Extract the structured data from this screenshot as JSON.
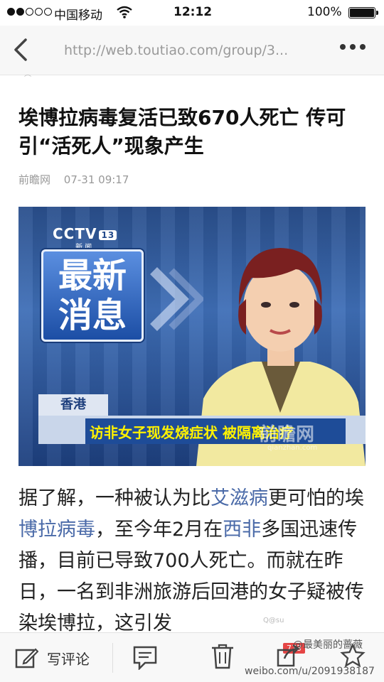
{
  "status_bar": {
    "carrier": "中国移动",
    "time": "12:12",
    "battery": "100%"
  },
  "nav": {
    "url": "http://web.toutiao.com/group/3..."
  },
  "article": {
    "title": "埃博拉病毒复活已致670人死亡 传可引“活死人”现象产生",
    "source": "前瞻网",
    "date": "07-31 09:17",
    "image": {
      "logo": "CCTV",
      "channel": "13",
      "channel_sub": "新闻",
      "badge": "最新消息",
      "location_tag": "香港",
      "ticker": "访非女子现发烧症状 被隔离治疗",
      "watermark": "前瞻网",
      "watermark_url": "qianzhan.com"
    },
    "body": {
      "p1": "据了解，一种被认为比",
      "kw1": "艾滋病",
      "p2": "更可怕的埃",
      "kw2": "博拉病毒",
      "p3": "，至今年2月在",
      "kw3": "西非",
      "p4": "多国迅速传播，目前已导致700人死亡。而就在昨日，一名到非洲旅游后回港的女子疑被传染埃博拉，这引发"
    },
    "signature": "Q@su"
  },
  "bottom_bar": {
    "comment_label": "写评论",
    "comment_count": "773",
    "weibo_user": "@最美丽的蔷薇",
    "weibo_url": "weibo.com/u/2091938187"
  }
}
